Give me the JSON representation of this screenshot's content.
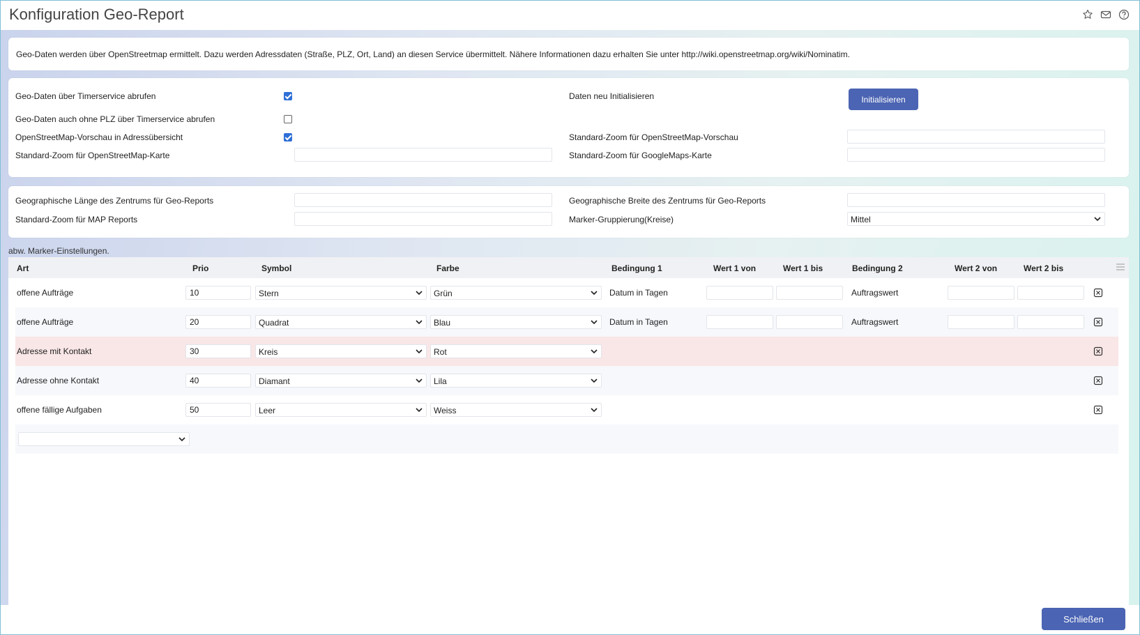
{
  "window": {
    "title": "Konfiguration Geo-Report"
  },
  "info": {
    "text": "Geo-Daten werden über OpenStreetmap ermittelt. Dazu werden Adressdaten (Straße, PLZ, Ort, Land) an diesen Service übermittelt. Nähere Informationen dazu erhalten Sie unter http://wiki.openstreetmap.org/wiki/Nominatim."
  },
  "settings": {
    "timer_label": "Geo-Daten über Timerservice abrufen",
    "timer_checked": true,
    "timer_noplz_label": "Geo-Daten auch ohne PLZ über Timerservice abrufen",
    "timer_noplz_checked": false,
    "osm_preview_label": "OpenStreetMap-Vorschau in Adressübersicht",
    "osm_preview_checked": true,
    "zoom_osm_map_label": "Standard-Zoom für OpenStreetMap-Karte",
    "zoom_osm_map_value": "",
    "reinit_label": "Daten neu Initialisieren",
    "reinit_button": "Initialisieren",
    "zoom_osm_preview_label": "Standard-Zoom für OpenStreetMap-Vorschau",
    "zoom_osm_preview_value": "",
    "zoom_gmaps_label": "Standard-Zoom für GoogleMaps-Karte",
    "zoom_gmaps_value": ""
  },
  "center": {
    "lon_label": "Geographische Länge des Zentrums für Geo-Reports",
    "lon_value": "",
    "zoom_map_label": "Standard-Zoom für MAP Reports",
    "zoom_map_value": "",
    "lat_label": "Geographische Breite des Zentrums für Geo-Reports",
    "lat_value": "",
    "cluster_label": "Marker-Gruppierung(Kreise)",
    "cluster_value": "Mittel"
  },
  "markers": {
    "section_label": "abw. Marker-Einstellungen.",
    "headers": {
      "art": "Art",
      "prio": "Prio",
      "symbol": "Symbol",
      "farbe": "Farbe",
      "bed1": "Bedingung 1",
      "w1von": "Wert 1 von",
      "w1bis": "Wert 1 bis",
      "bed2": "Bedingung 2",
      "w2von": "Wert 2 von",
      "w2bis": "Wert 2 bis"
    },
    "rows": [
      {
        "art": "offene Aufträge",
        "prio": "10",
        "symbol": "Stern",
        "farbe": "Grün",
        "bed1": "Datum in Tagen",
        "bed2": "Auftragswert"
      },
      {
        "art": "offene Aufträge",
        "prio": "20",
        "symbol": "Quadrat",
        "farbe": "Blau",
        "bed1": "Datum in Tagen",
        "bed2": "Auftragswert"
      },
      {
        "art": "Adresse mit Kontakt",
        "prio": "30",
        "symbol": "Kreis",
        "farbe": "Rot",
        "bed1": "",
        "bed2": ""
      },
      {
        "art": "Adresse ohne Kontakt",
        "prio": "40",
        "symbol": "Diamant",
        "farbe": "Lila",
        "bed1": "",
        "bed2": ""
      },
      {
        "art": "offene fällige Aufgaben",
        "prio": "50",
        "symbol": "Leer",
        "farbe": "Weiss",
        "bed1": "",
        "bed2": ""
      }
    ],
    "new_row_value": ""
  },
  "footer": {
    "close_button": "Schließen"
  },
  "colors": {
    "accent": "#4b64b3",
    "checkbox": "#2f6fd6",
    "highlight_row": "#f9e6e6"
  },
  "icons": [
    "star-icon",
    "mail-icon",
    "help-icon",
    "chevron-down-icon",
    "menu-icon",
    "delete-icon"
  ]
}
